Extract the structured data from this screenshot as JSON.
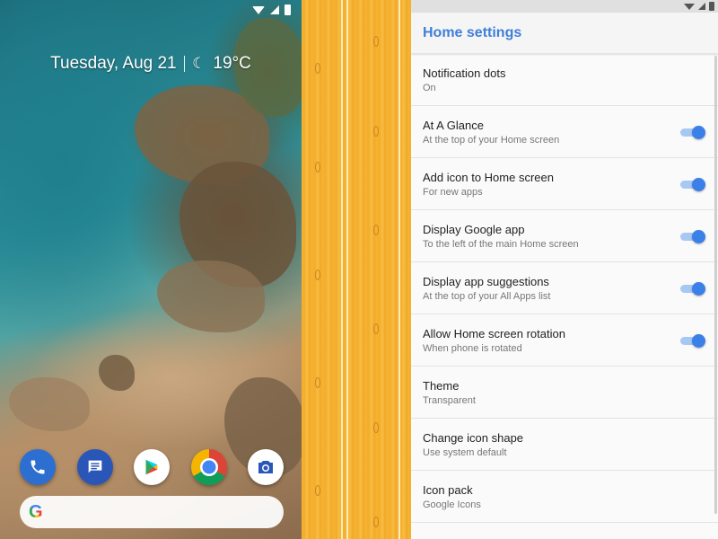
{
  "home": {
    "glance": {
      "date": "Tuesday, Aug 21",
      "weather_icon": "moon-icon",
      "temperature": "19°C"
    },
    "dock": [
      {
        "name": "phone-app-icon",
        "icon": "phone-icon"
      },
      {
        "name": "messages-app-icon",
        "icon": "message-icon"
      },
      {
        "name": "play-store-app-icon",
        "icon": "play-triangle-icon"
      },
      {
        "name": "chrome-app-icon",
        "icon": "chrome-icon"
      },
      {
        "name": "camera-app-icon",
        "icon": "camera-icon"
      }
    ],
    "search": {
      "logo": "G"
    }
  },
  "settings": {
    "title": "Home settings",
    "accent": "#3a80e8",
    "items": [
      {
        "title": "Notification dots",
        "subtitle": "On",
        "toggle": false
      },
      {
        "title": "At A Glance",
        "subtitle": "At the top of your Home screen",
        "toggle": true,
        "on": true
      },
      {
        "title": "Add icon to Home screen",
        "subtitle": "For new apps",
        "toggle": true,
        "on": true
      },
      {
        "title": "Display Google app",
        "subtitle": "To the left of the main Home screen",
        "toggle": true,
        "on": true
      },
      {
        "title": "Display app suggestions",
        "subtitle": "At the top of your All Apps list",
        "toggle": true,
        "on": true
      },
      {
        "title": "Allow Home screen rotation",
        "subtitle": "When phone is rotated",
        "toggle": true,
        "on": true
      },
      {
        "title": "Theme",
        "subtitle": "Transparent",
        "toggle": false
      },
      {
        "title": "Change icon shape",
        "subtitle": "Use system default",
        "toggle": false
      },
      {
        "title": "Icon pack",
        "subtitle": "Google Icons",
        "toggle": false
      }
    ]
  }
}
